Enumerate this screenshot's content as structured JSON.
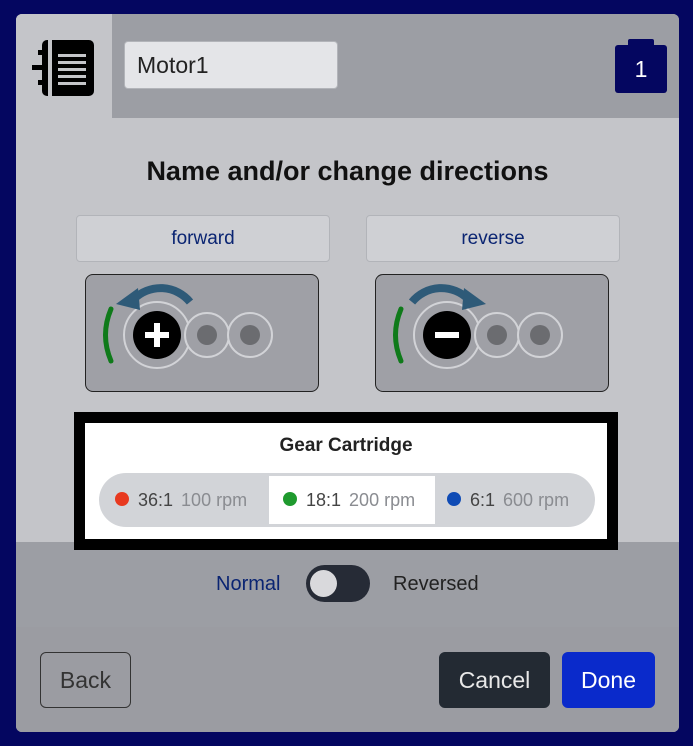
{
  "header": {
    "motor_name": "Motor1",
    "port_number": "1"
  },
  "title": "Name and/or change directions",
  "directions": {
    "forward_label": "forward",
    "reverse_label": "reverse"
  },
  "gear_cartridge": {
    "title": "Gear Cartridge",
    "selected": "18:1",
    "options": [
      {
        "ratio": "36:1",
        "rpm": "100 rpm",
        "color": "#e8391f"
      },
      {
        "ratio": "18:1",
        "rpm": "200 rpm",
        "color": "#1f9a2e"
      },
      {
        "ratio": "6:1",
        "rpm": "600 rpm",
        "color": "#0f4bb5"
      }
    ]
  },
  "direction_toggle": {
    "left_label": "Normal",
    "right_label": "Reversed",
    "state": "Normal"
  },
  "buttons": {
    "back": "Back",
    "cancel": "Cancel",
    "done": "Done"
  },
  "colors": {
    "background": "#040660",
    "accent": "#0a2acb",
    "forward_arc": "#0f7a1a",
    "rotation_arrow": "#2e5a78"
  },
  "icons": {
    "motor": "smart-motor-icon",
    "port": "battery-port-icon",
    "forward": "counterclockwise-arrow-plus-icon",
    "reverse": "clockwise-arrow-minus-icon"
  }
}
